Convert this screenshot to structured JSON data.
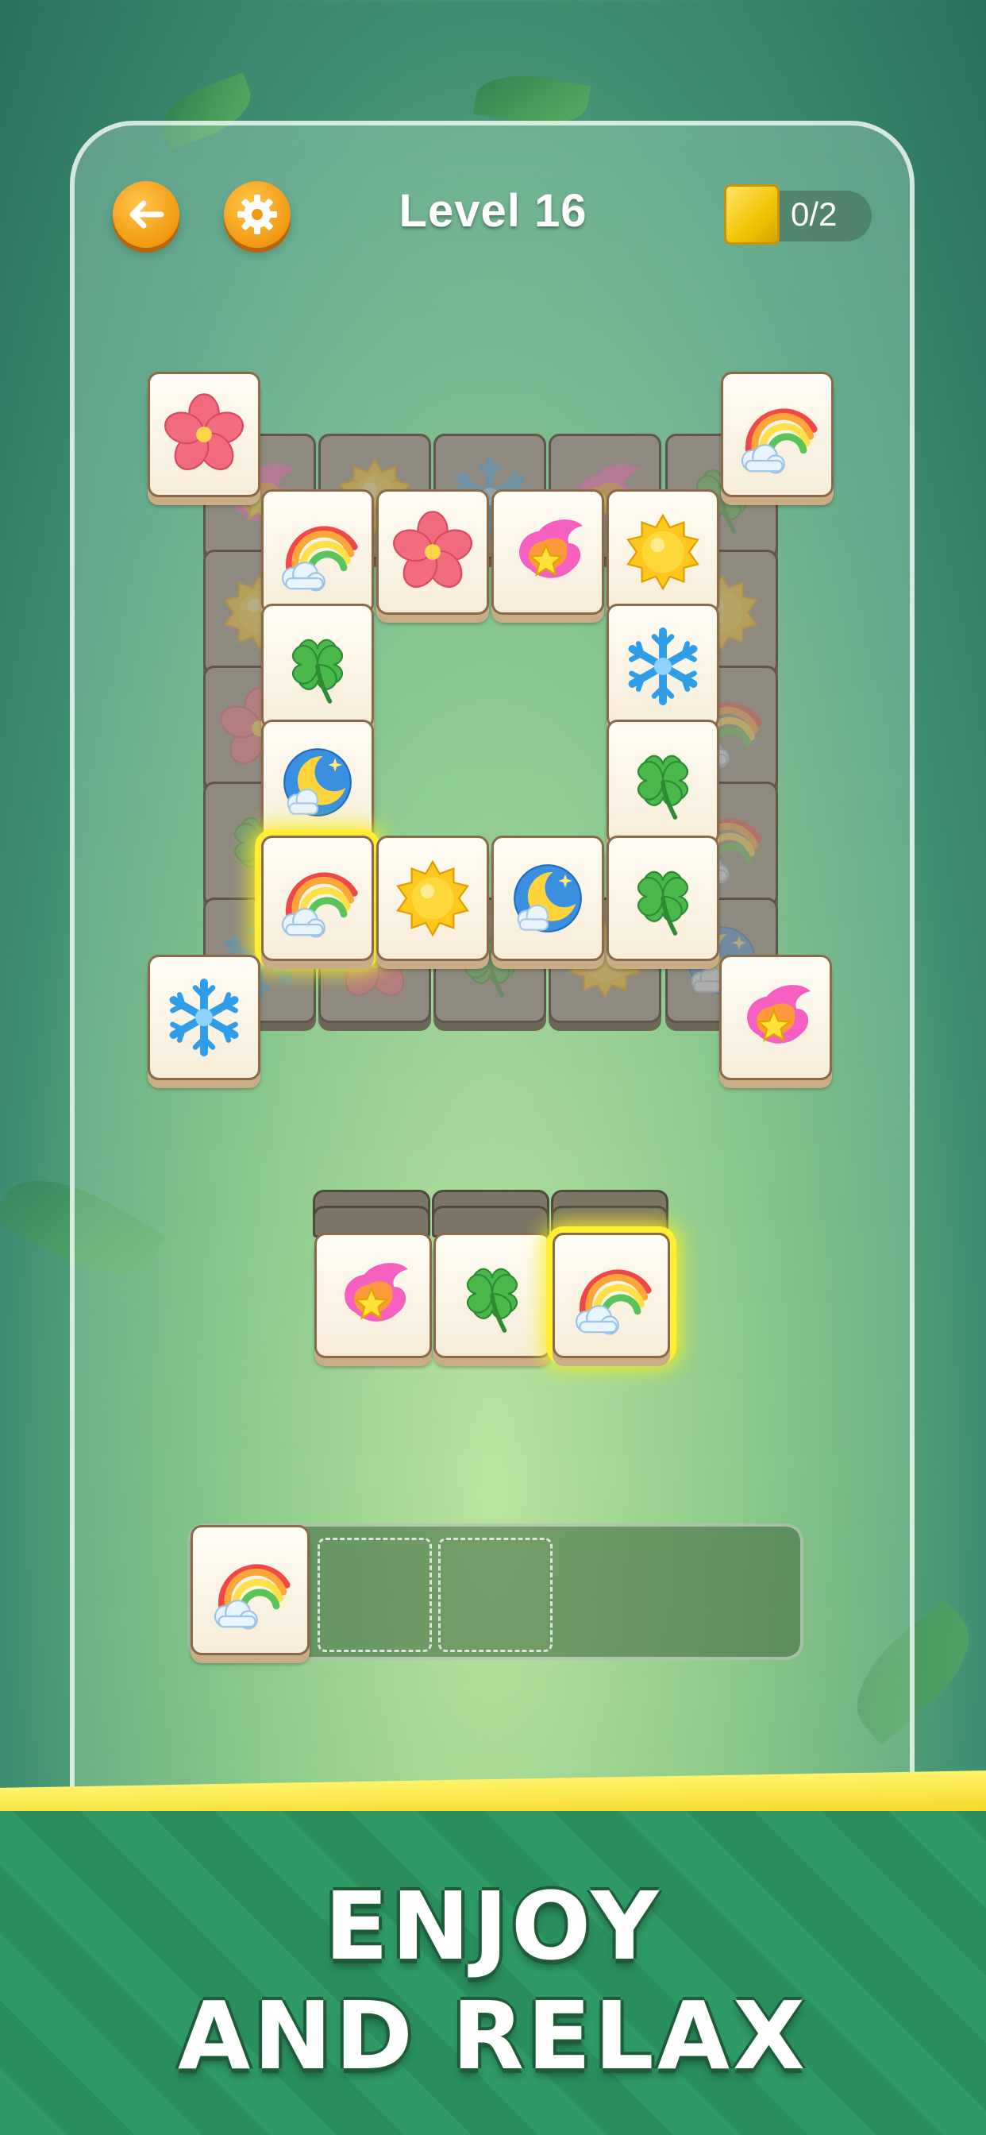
{
  "header": {
    "back_icon": "arrow-left-icon",
    "settings_icon": "gear-icon",
    "level_title": "Level 16",
    "counter_text": "0/2",
    "counter_icon": "gold-tile-icon"
  },
  "board": {
    "tile_types": [
      "flower",
      "rainbow",
      "comet",
      "sun",
      "clover",
      "snowflake",
      "moon"
    ],
    "top_layer": [
      "flower",
      "rainbow",
      "rainbow",
      "flower",
      "comet",
      "sun",
      "clover",
      "snowflake",
      "moon",
      "clover",
      "rainbow",
      "sun",
      "moon",
      "clover",
      "snowflake",
      "comet"
    ],
    "highlighted_tile": "rainbow"
  },
  "stack": {
    "visible_tiles": [
      "comet",
      "clover",
      "rainbow"
    ],
    "highlighted_tile": "rainbow"
  },
  "tray": {
    "slots_filled": [
      "rainbow"
    ],
    "empty_slots": 2
  },
  "banner": {
    "line1": "ENJOY",
    "line2": "AND RELAX"
  },
  "colors": {
    "accent_orange": "#f39a12",
    "highlight_yellow": "#ffee33",
    "banner_green": "#2f9a64"
  }
}
